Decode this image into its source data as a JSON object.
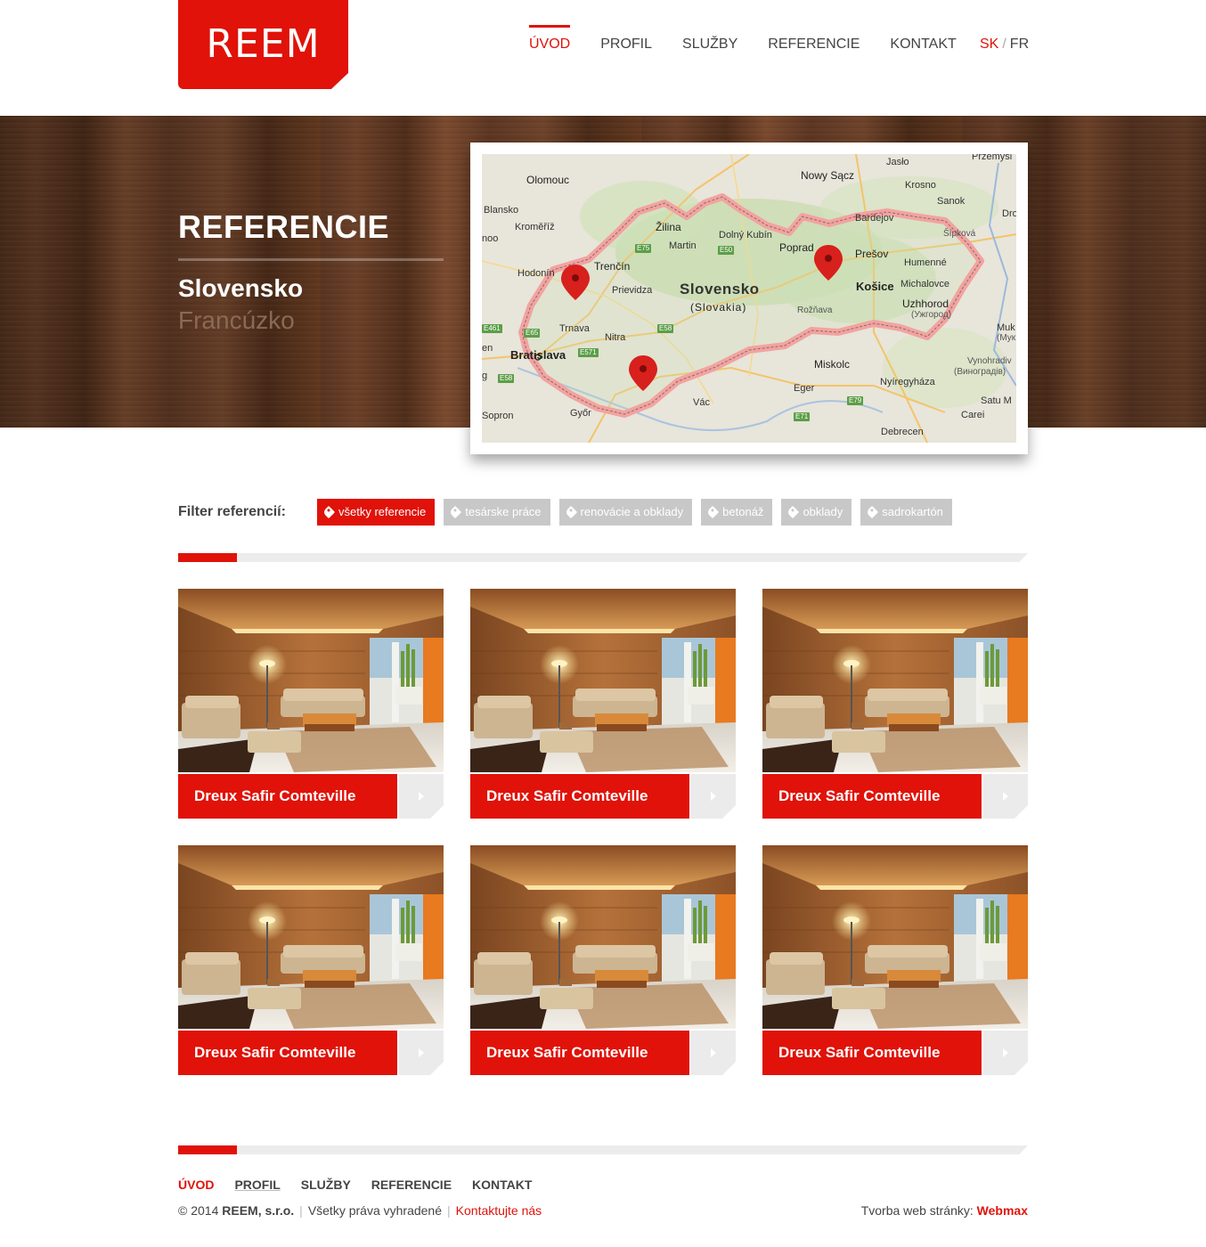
{
  "header": {
    "logo_text": "REEM",
    "nav": [
      {
        "label": "ÚVOD",
        "active": true
      },
      {
        "label": "PROFIL",
        "active": false
      },
      {
        "label": "SLUŽBY",
        "active": false
      },
      {
        "label": "REFERENCIE",
        "active": false
      },
      {
        "label": "KONTAKT",
        "active": false
      }
    ],
    "lang": {
      "active": "SK",
      "separator": "/",
      "other": "FR"
    }
  },
  "hero": {
    "title": "REFERENCIE",
    "countries": [
      "Slovensko",
      "Francúzko"
    ]
  },
  "map": {
    "country_label": "Slovensko",
    "country_label_local": "(Slovakia)",
    "cities": [
      "Olomouc",
      "Blansko",
      "Kroměříž",
      "Hodonín",
      "Trenčín",
      "Prievidza",
      "Žilina",
      "Martin",
      "Dolný Kubín",
      "Poprad",
      "Nowy Sącz",
      "Jasło",
      "Krosno",
      "Sanok",
      "Przemyśl",
      "Bardejov",
      "Prešov",
      "Humenné",
      "Košice",
      "Michalovce",
      "Uzhhorod",
      "(Ужгород)",
      "Rožňava",
      "Trnava",
      "Nitra",
      "Bratislava",
      "Miskolc",
      "Eger",
      "Nyíregyháza",
      "Vác",
      "Győr",
      "Sopron",
      "Debrecen",
      "Vynohradiv",
      "(Виноградів)",
      "Satu M",
      "Carei",
      "Šípková",
      "Dro",
      "Muk",
      "(Мук",
      "noo",
      "en",
      "g"
    ],
    "roads": [
      "E75",
      "E50",
      "E65",
      "E58",
      "E571",
      "E461",
      "E58",
      "E79",
      "E71"
    ]
  },
  "filter": {
    "label": "Filter referencií:",
    "tags": [
      {
        "label": "všetky referencie",
        "active": true
      },
      {
        "label": "tesárske práce",
        "active": false
      },
      {
        "label": "renovácie a obklady",
        "active": false
      },
      {
        "label": "betonáž",
        "active": false
      },
      {
        "label": "obklady",
        "active": false
      },
      {
        "label": "sadrokartón",
        "active": false
      }
    ]
  },
  "references": [
    {
      "title": "Dreux Safir Comteville"
    },
    {
      "title": "Dreux Safir Comteville"
    },
    {
      "title": "Dreux Safir Comteville"
    },
    {
      "title": "Dreux Safir Comteville"
    },
    {
      "title": "Dreux Safir Comteville"
    },
    {
      "title": "Dreux Safir Comteville"
    }
  ],
  "footer": {
    "nav": [
      "ÚVOD",
      "PROFIL",
      "SLUŽBY",
      "REFERENCIE",
      "KONTAKT"
    ],
    "copyright_prefix": "© 2014",
    "company": "REEM, s.r.o.",
    "rights": "Všetky práva vyhradené",
    "contact_link": "Kontaktujte nás",
    "credit_prefix": "Tvorba web stránky:",
    "credit_brand": "Webmax"
  },
  "colors": {
    "accent": "#e01209",
    "tag_inactive": "#c8c8c8"
  }
}
